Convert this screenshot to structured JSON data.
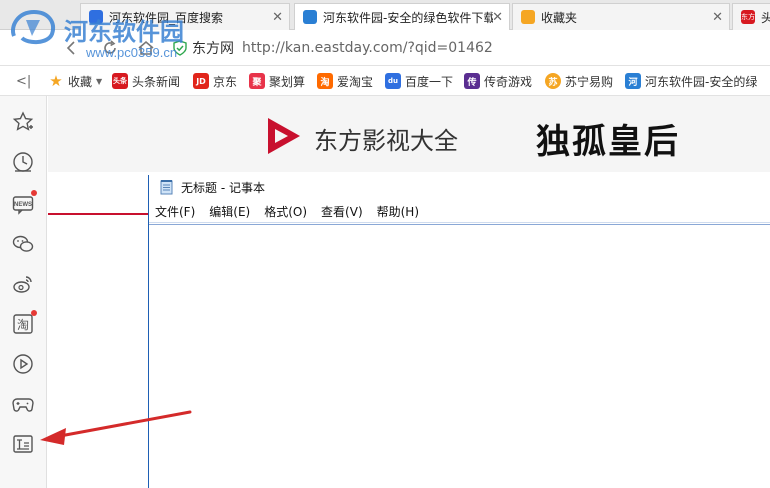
{
  "tabs": [
    {
      "title": "河东软件园_百度搜索",
      "favicon_color": "#2f6fe0"
    },
    {
      "title": "河东软件园-安全的绿色软件下载",
      "favicon_color": "#2a7fd4"
    },
    {
      "title": "收藏夹",
      "favicon_color": "#f5a623"
    },
    {
      "title": "头",
      "favicon_badge": "东方",
      "favicon_color": "#d71920"
    }
  ],
  "close_glyph": "✕",
  "address": {
    "site_name": "东方网",
    "url": "http://kan.eastday.com/?qid=01462"
  },
  "bookmarks": {
    "toggle_glyph": "<|",
    "items": [
      {
        "label": "收藏",
        "icon": "star-icon",
        "color": "#f5a623"
      },
      {
        "label": "头条新闻",
        "badge": "头条",
        "color": "#d71920"
      },
      {
        "label": "京东",
        "badge": "JD",
        "color": "#e1251b"
      },
      {
        "label": "聚划算",
        "badge": "聚",
        "color": "#e8334a"
      },
      {
        "label": "爱淘宝",
        "badge": "淘",
        "color": "#ff6a00"
      },
      {
        "label": "百度一下",
        "badge": "du",
        "color": "#2f6fe0"
      },
      {
        "label": "传奇游戏",
        "badge": "传",
        "color": "#5a2e91"
      },
      {
        "label": "苏宁易购",
        "badge": "苏",
        "color": "#f5a623"
      },
      {
        "label": "河东软件园-安全的绿",
        "badge": "河",
        "color": "#2a7fd4"
      }
    ]
  },
  "sidebar": {
    "items": [
      {
        "name": "favorites-star-icon"
      },
      {
        "name": "history-clock-icon"
      },
      {
        "name": "news-icon",
        "badge": "NEWS",
        "dot": true
      },
      {
        "name": "wechat-icon"
      },
      {
        "name": "weibo-icon"
      },
      {
        "name": "taobao-icon",
        "badge": "淘",
        "dot": true
      },
      {
        "name": "video-play-icon"
      },
      {
        "name": "gamepad-icon"
      },
      {
        "name": "notepad-icon"
      }
    ]
  },
  "banner": {
    "brand": "东方影视大全",
    "calligraphy": "独孤皇后",
    "brand_color": "#c8102e"
  },
  "notepad": {
    "title": "无标题 - 记事本",
    "menu": [
      "文件(F)",
      "编辑(E)",
      "格式(O)",
      "查看(V)",
      "帮助(H)"
    ],
    "accent": "#1e5fb4"
  },
  "watermark": {
    "name": "河东软件园",
    "url": "www.pc0359.cn",
    "color": "#3a82d3"
  },
  "arrow_color": "#d42a2a"
}
